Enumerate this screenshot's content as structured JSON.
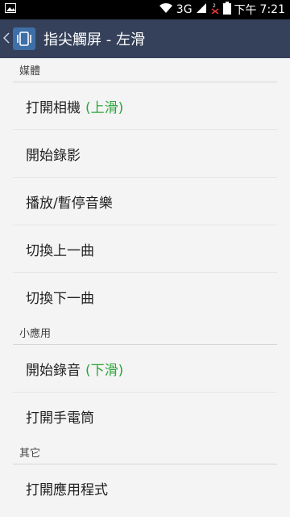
{
  "status_bar": {
    "network": "3G",
    "time_prefix": "下午",
    "time": "7:21"
  },
  "header": {
    "title": "指尖觸屏 - 左滑"
  },
  "sections": [
    {
      "header": "媒體",
      "items": [
        {
          "label": "打開相機",
          "hint": "(上滑)"
        },
        {
          "label": "開始錄影",
          "hint": ""
        },
        {
          "label": "播放/暫停音樂",
          "hint": ""
        },
        {
          "label": "切換上一曲",
          "hint": ""
        },
        {
          "label": "切換下一曲",
          "hint": ""
        }
      ]
    },
    {
      "header": "小應用",
      "items": [
        {
          "label": "開始錄音",
          "hint": "(下滑)"
        },
        {
          "label": "打開手電筒",
          "hint": ""
        }
      ]
    },
    {
      "header": "其它",
      "items": [
        {
          "label": "打開應用程式",
          "hint": ""
        }
      ]
    }
  ],
  "colors": {
    "action_bar": "#35415a",
    "hint": "#2aa63a",
    "background": "#f4f4f4"
  }
}
